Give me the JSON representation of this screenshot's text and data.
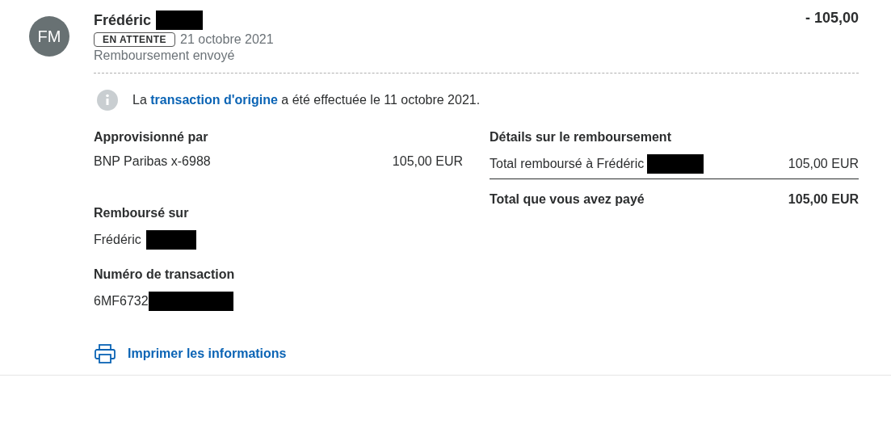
{
  "avatar": {
    "initials": "FM"
  },
  "header": {
    "name": "Frédéric",
    "amount": "- 105,00",
    "status": "EN ATTENTE",
    "date": "21 octobre 2021",
    "description": "Remboursement envoyé"
  },
  "notice": {
    "before": "La",
    "link": "transaction d'origine",
    "after": "a été effectuée le 11 octobre 2021."
  },
  "funded_by": {
    "title": "Approvisionné par",
    "source": "BNP Paribas x-6988",
    "amount": "105,00 EUR"
  },
  "refunded_to": {
    "title": "Remboursé sur",
    "name": "Frédéric"
  },
  "transaction": {
    "title": "Numéro de transaction",
    "number": "6MF6732"
  },
  "refund_details": {
    "title": "Détails sur le remboursement",
    "rows": [
      {
        "label": "Total remboursé à Frédéric",
        "value": "105,00 EUR"
      }
    ],
    "total": {
      "label": "Total que vous avez payé",
      "value": "105,00 EUR"
    }
  },
  "print_link": "Imprimer les informations"
}
